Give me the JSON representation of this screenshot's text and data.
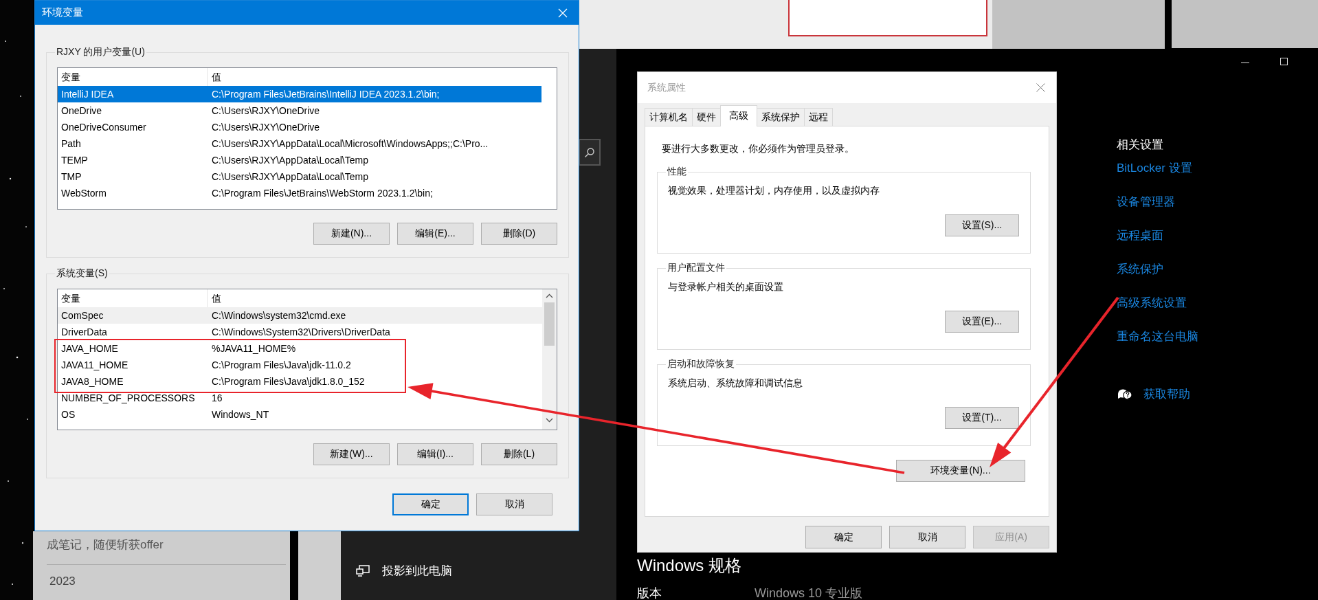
{
  "env_dialog": {
    "title": "环境变量",
    "user_vars": {
      "label": "RJXY 的用户变量(U)",
      "focused": true,
      "columns": [
        "变量",
        "值"
      ],
      "rows": [
        {
          "name": "IntelliJ IDEA",
          "value": "C:\\Program Files\\JetBrains\\IntelliJ IDEA 2023.1.2\\bin;",
          "selected": true
        },
        {
          "name": "OneDrive",
          "value": "C:\\Users\\RJXY\\OneDrive",
          "selected": false
        },
        {
          "name": "OneDriveConsumer",
          "value": "C:\\Users\\RJXY\\OneDrive",
          "selected": false
        },
        {
          "name": "Path",
          "value": "C:\\Users\\RJXY\\AppData\\Local\\Microsoft\\WindowsApps;;C:\\Pro...",
          "selected": false
        },
        {
          "name": "TEMP",
          "value": "C:\\Users\\RJXY\\AppData\\Local\\Temp",
          "selected": false
        },
        {
          "name": "TMP",
          "value": "C:\\Users\\RJXY\\AppData\\Local\\Temp",
          "selected": false
        },
        {
          "name": "WebStorm",
          "value": "C:\\Program Files\\JetBrains\\WebStorm 2023.1.2\\bin;",
          "selected": false
        }
      ],
      "buttons": [
        "新建(N)...",
        "编辑(E)...",
        "删除(D)"
      ]
    },
    "system_vars": {
      "label": "系统变量(S)",
      "focused": false,
      "columns": [
        "变量",
        "值"
      ],
      "rows": [
        {
          "name": "ComSpec",
          "value": "C:\\Windows\\system32\\cmd.exe",
          "selected": true
        },
        {
          "name": "DriverData",
          "value": "C:\\Windows\\System32\\Drivers\\DriverData",
          "selected": false
        },
        {
          "name": "JAVA_HOME",
          "value": "%JAVA11_HOME%",
          "selected": false
        },
        {
          "name": "JAVA11_HOME",
          "value": "C:\\Program Files\\Java\\jdk-11.0.2",
          "selected": false
        },
        {
          "name": "JAVA8_HOME",
          "value": "C:\\Program Files\\Java\\jdk1.8.0_152",
          "selected": false
        },
        {
          "name": "NUMBER_OF_PROCESSORS",
          "value": "16",
          "selected": false
        },
        {
          "name": "OS",
          "value": "Windows_NT",
          "selected": false
        }
      ],
      "buttons": [
        "新建(W)...",
        "编辑(I)...",
        "删除(L)"
      ]
    },
    "buttons": [
      {
        "label": "确定",
        "default": true
      },
      {
        "label": "取消",
        "default": false
      }
    ]
  },
  "system_properties": {
    "title": "系统属性",
    "tabs": [
      {
        "label": "计算机名",
        "selected": false
      },
      {
        "label": "硬件",
        "selected": false
      },
      {
        "label": "高级",
        "selected": true
      },
      {
        "label": "系统保护",
        "selected": false
      },
      {
        "label": "远程",
        "selected": false
      }
    ],
    "notice": "要进行大多数更改，你必须作为管理员登录。",
    "groups": [
      {
        "title": "性能",
        "description": "视觉效果，处理器计划，内存使用，以及虚拟内存",
        "button": "设置(S)..."
      },
      {
        "title": "用户配置文件",
        "description": "与登录帐户相关的桌面设置",
        "button": "设置(E)..."
      },
      {
        "title": "启动和故障恢复",
        "description": "系统启动、系统故障和调试信息",
        "button": "设置(T)..."
      }
    ],
    "env_button": "环境变量(N)...",
    "buttons": [
      {
        "label": "确定",
        "disabled": false
      },
      {
        "label": "取消",
        "disabled": false
      },
      {
        "label": "应用(A)",
        "disabled": true
      }
    ]
  },
  "settings": {
    "related_title": "相关设置",
    "links": [
      "BitLocker 设置",
      "设备管理器",
      "远程桌面",
      "系统保护",
      "高级系统设置",
      "重命名这台电脑"
    ],
    "help": "获取帮助",
    "spec_title": "Windows 规格",
    "spec_rows": [
      {
        "label": "版本",
        "value": "Windows 10 专业版"
      }
    ]
  },
  "background": {
    "menu_items": [
      "投影到此电脑"
    ],
    "page_text": "成笔记，随便斩获offer",
    "year": "2023"
  }
}
